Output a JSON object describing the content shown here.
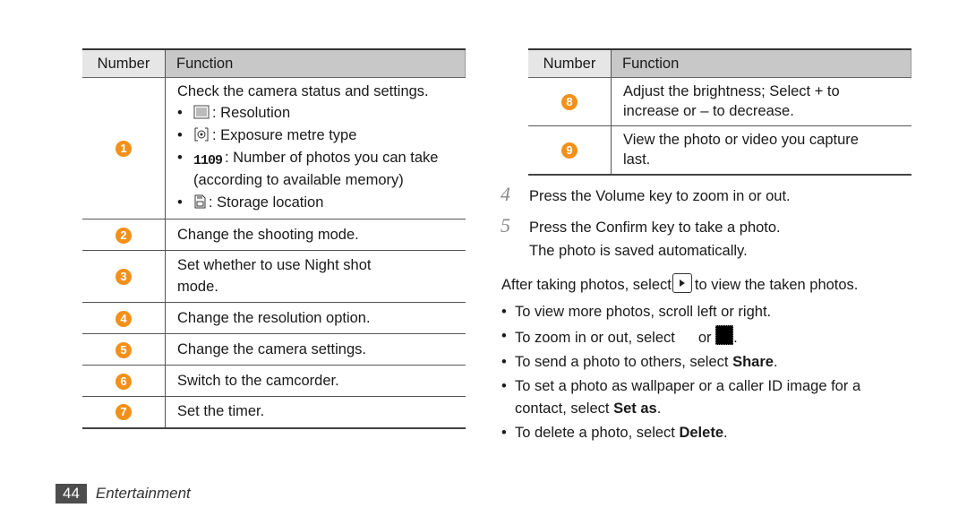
{
  "left_table": {
    "headers": {
      "number": "Number",
      "function": "Function"
    },
    "rows": [
      {
        "number": "1",
        "function": "Check the camera status and settings.",
        "bullets": [
          {
            "icon": "resolution-icon",
            "text": ": Resolution"
          },
          {
            "icon": "exposure-metre-icon",
            "text": ": Exposure metre type"
          },
          {
            "icon": "photo-count-icon",
            "icon_text": "1109",
            "text": ": Number of photos you can take (according to available memory)"
          },
          {
            "icon": "storage-icon",
            "text": ": Storage location"
          }
        ]
      },
      {
        "number": "2",
        "function": "Change the shooting mode."
      },
      {
        "number": "3",
        "function": "Set whether to use Night shot mode."
      },
      {
        "number": "4",
        "function": "Change the resolution option."
      },
      {
        "number": "5",
        "function": "Change the camera settings."
      },
      {
        "number": "6",
        "function": "Switch to the camcorder."
      },
      {
        "number": "7",
        "function": "Set the timer."
      }
    ]
  },
  "right_table": {
    "headers": {
      "number": "Number",
      "function": "Function"
    },
    "rows": [
      {
        "number": "8",
        "function": "Adjust the brightness; Select + to increase or – to decrease."
      },
      {
        "number": "9",
        "function": "View the photo or video you capture last."
      }
    ]
  },
  "steps": [
    {
      "n": "4",
      "text": "Press the Volume key to zoom in or out."
    },
    {
      "n": "5",
      "text": "Press the Confirm key to take a photo.",
      "sub": "The photo is saved automatically."
    }
  ],
  "after": {
    "before": "After taking photos, select",
    "icon": "play-icon",
    "after": "to view the taken photos."
  },
  "bullets": [
    {
      "text": "To view more photos, scroll left or right."
    },
    {
      "pre": "To zoom in or out, select",
      "mid": "or",
      "post": "."
    },
    {
      "pre": "To send a photo to others, select ",
      "bold": "Share",
      "post": "."
    },
    {
      "pre": "To set a photo as wallpaper or a caller ID image for a contact, select ",
      "bold": "Set as",
      "post": "."
    },
    {
      "pre": "To delete a photo, select ",
      "bold": "Delete",
      "post": "."
    }
  ],
  "footer": {
    "page": "44",
    "section": "Entertainment"
  },
  "colors": {
    "badge": "#f39019",
    "header_number_bg": "#e6e6e6",
    "header_function_bg": "#c8c8c8"
  }
}
